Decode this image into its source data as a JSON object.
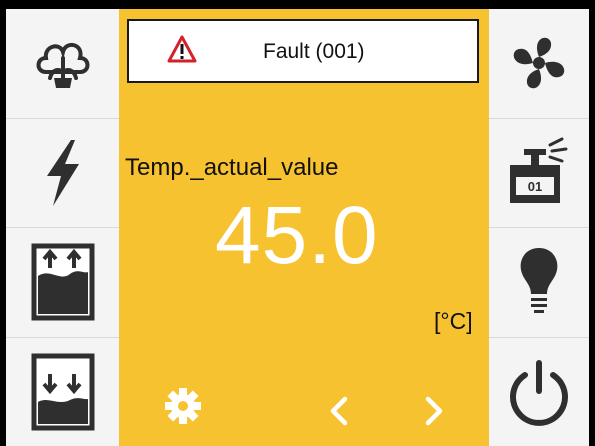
{
  "fault": {
    "text": "Fault (001)",
    "icon": "warning-icon"
  },
  "measurement": {
    "label": "Temp._actual_value",
    "value": "45.0",
    "unit": "[°C]"
  },
  "left_buttons": [
    "steam-icon",
    "lightning-icon",
    "fill-up-icon",
    "drain-down-icon"
  ],
  "right_buttons": [
    "fan-icon",
    "program-01-icon",
    "lightbulb-icon",
    "power-icon"
  ],
  "right_program": {
    "number": "01"
  },
  "bottom_controls": [
    "settings-gear-icon",
    "chevron-left-icon",
    "chevron-right-icon"
  ],
  "colors": {
    "accent": "#f7c22f",
    "icon": "#2f2f2f",
    "warning": "#d3222a"
  }
}
